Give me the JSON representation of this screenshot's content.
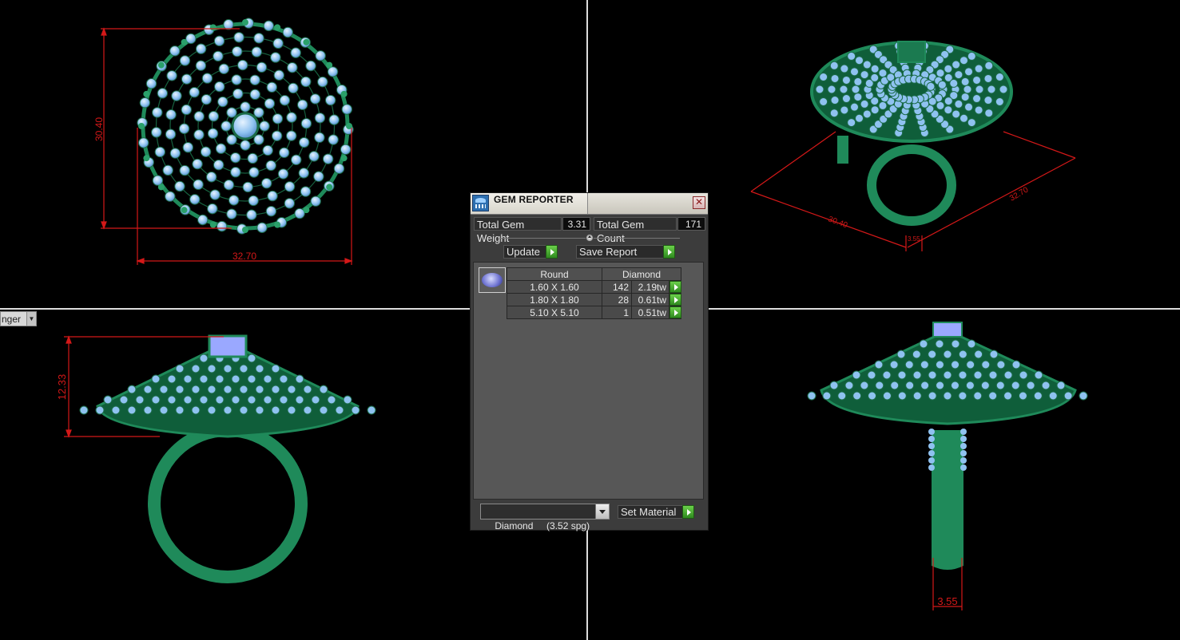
{
  "viewports": {
    "top_left": {
      "dim_height": "30.40",
      "dim_width": "32.70"
    },
    "top_right": {
      "dim_left": "30.40",
      "dim_right": "32.70",
      "dim_shank": "3.55"
    },
    "bottom_left": {
      "dim_height": "12.33",
      "view_menu_label": "nger"
    },
    "bottom_right": {
      "dim_shank": "3.55"
    }
  },
  "panel": {
    "title": "GEM REPORTER",
    "total_weight_label": "Total Gem Weight",
    "total_weight_value": "3.31",
    "total_count_label": "Total Gem Count",
    "total_count_value": "171",
    "update_label": "Update",
    "save_report_label": "Save Report",
    "table": {
      "shape": "Round",
      "material": "Diamond",
      "rows": [
        {
          "size": "1.60 X 1.60",
          "count": "142",
          "weight": "2.19tw"
        },
        {
          "size": "1.80 X 1.80",
          "count": "28",
          "weight": "0.61tw"
        },
        {
          "size": "5.10 X 5.10",
          "count": "1",
          "weight": "0.51tw"
        }
      ]
    },
    "material_select_value": "Diamond     (3.52 spg)",
    "set_material_label": "Set Material"
  },
  "colors": {
    "metal": "#1f8a5a",
    "gem": "#8fc2f0",
    "dimension": "#d41818",
    "panel_bg": "#3c3c3c"
  }
}
